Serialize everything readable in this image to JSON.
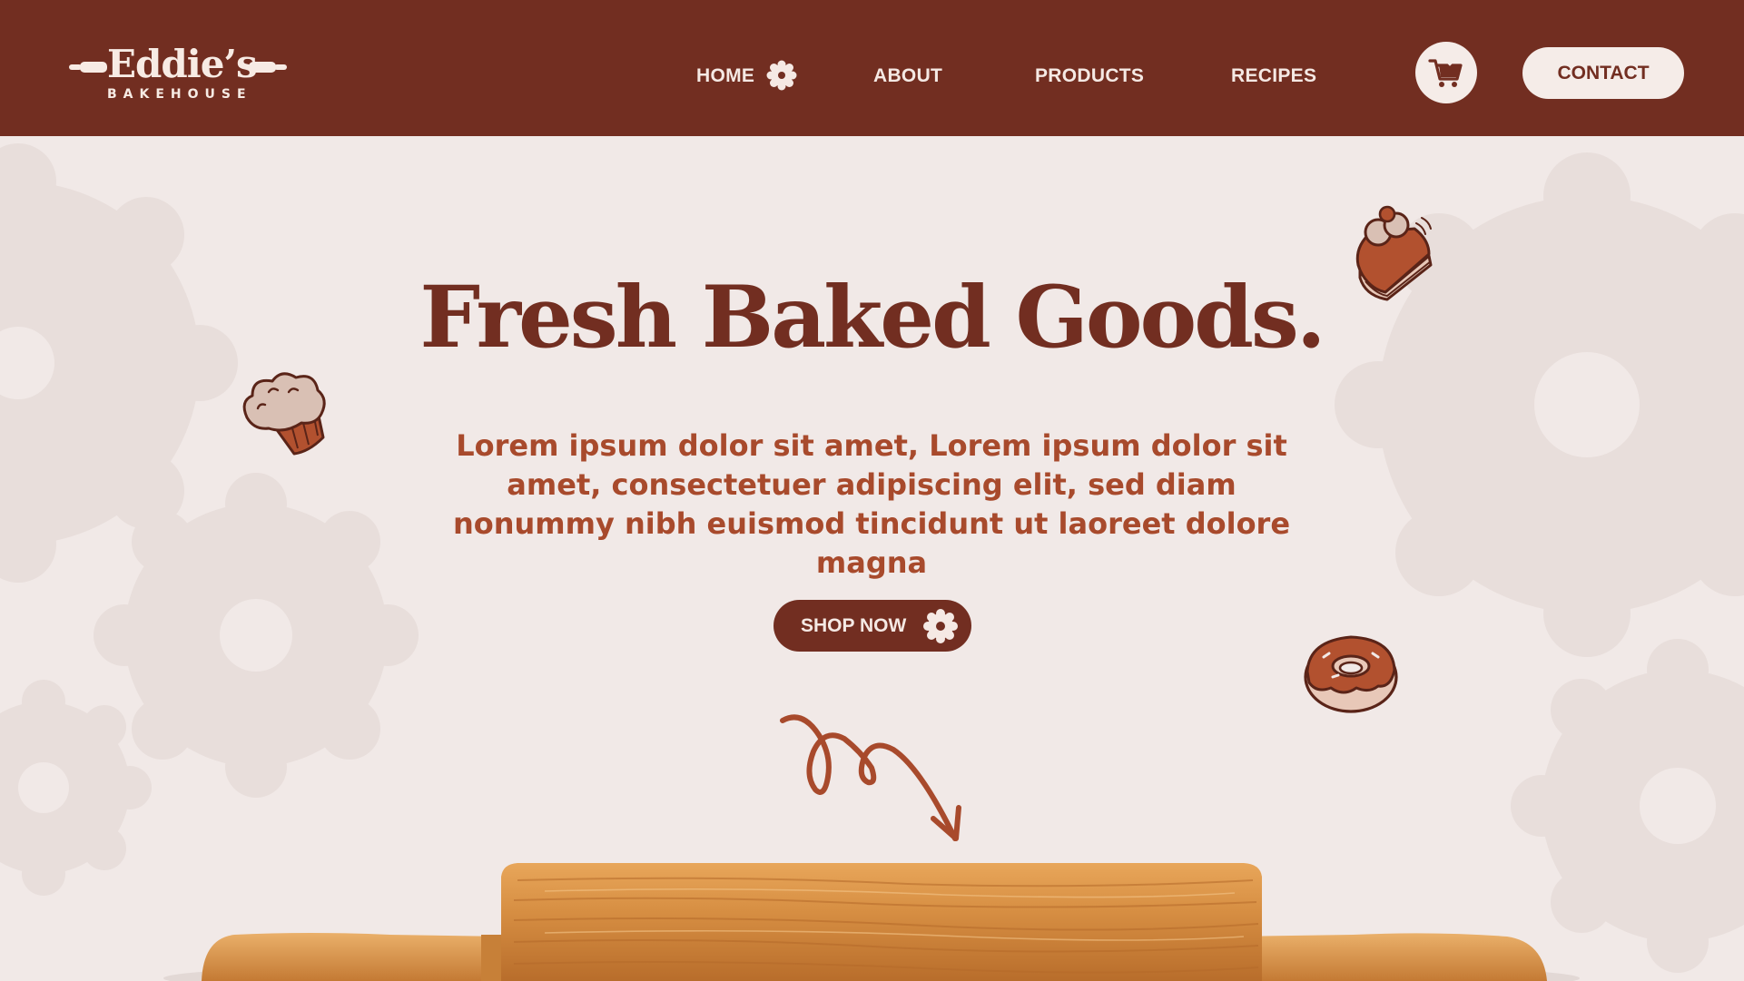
{
  "brand": {
    "name": "Eddie’s",
    "tagline": "BAKEHOUSE"
  },
  "nav": {
    "items": [
      {
        "label": "HOME"
      },
      {
        "label": "ABOUT"
      },
      {
        "label": "PRODUCTS"
      },
      {
        "label": "RECIPES"
      }
    ],
    "cart_icon": "cart-icon",
    "contact_label": "CONTACT"
  },
  "hero": {
    "headline": "Fresh Baked Goods.",
    "body": "Lorem ipsum dolor sit amet, Lorem ipsum dolor sit amet, consectetuer adipiscing elit, sed diam nonummy nibh euismod tincidunt ut laoreet dolore magna",
    "cta_label": "SHOP NOW",
    "icons": [
      "muffin-icon",
      "cake-icon",
      "donut-icon",
      "arrow-icon",
      "flower-icon",
      "rolling-pin-icon"
    ]
  },
  "colors": {
    "header_bg": "#722e21",
    "page_bg": "#f1e9e7",
    "accent_text": "#a84a2c",
    "button_light": "#f5ece8"
  }
}
